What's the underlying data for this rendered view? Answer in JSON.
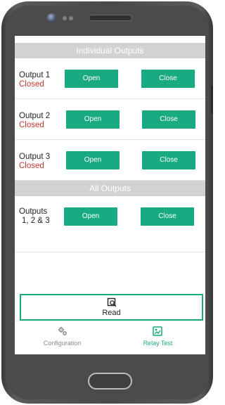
{
  "sections": {
    "individual_title": "Individual Outputs",
    "all_title": "All Outputs"
  },
  "outputs": [
    {
      "label": "Output 1",
      "status": "Closed",
      "open_label": "Open",
      "close_label": "Close"
    },
    {
      "label": "Output 2",
      "status": "Closed",
      "open_label": "Open",
      "close_label": "Close"
    },
    {
      "label": "Output 3",
      "status": "Closed",
      "open_label": "Open",
      "close_label": "Close"
    }
  ],
  "all_outputs": {
    "label_line1": "Outputs",
    "label_line2": "1, 2 & 3",
    "open_label": "Open",
    "close_label": "Close"
  },
  "read": {
    "label": "Read",
    "icon": "read-search-icon"
  },
  "tabs": [
    {
      "label": "Configuration",
      "icon": "gears-icon",
      "active": false
    },
    {
      "label": "Relay Test",
      "icon": "relay-test-icon",
      "active": true
    }
  ],
  "colors": {
    "accent": "#19aa81",
    "status_closed": "#c0392b",
    "header_bg": "#d2d2d2",
    "tab_inactive": "#8a8a8a"
  }
}
